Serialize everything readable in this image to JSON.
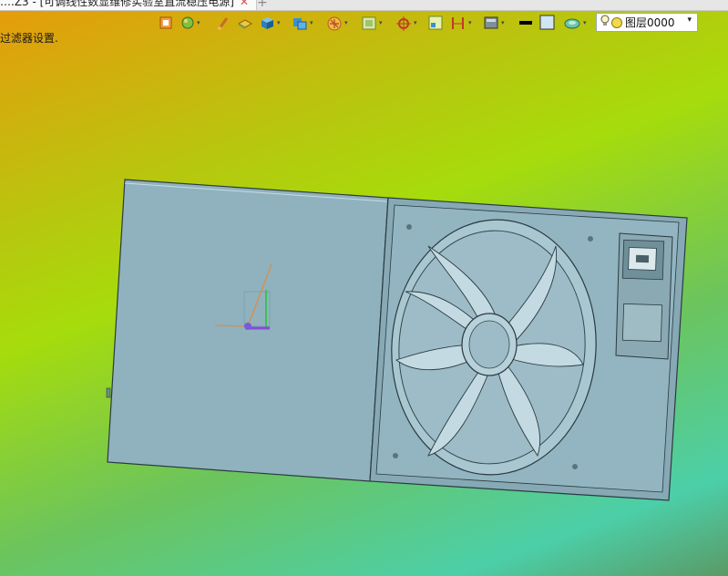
{
  "tab": {
    "title": "….Z3 - [可调线性数显维修实验室直流稳压电源]",
    "close_glyph": "✕",
    "add_glyph": "+"
  },
  "toolbar": {
    "icons": [
      "import-icon",
      "paint-icon",
      "brush-icon",
      "layer-block-icon",
      "solid-cube-icon",
      "view-cube-icon",
      "render-icon",
      "frame-icon",
      "snap-icon",
      "measure-box-icon",
      "dimension-icon",
      "display-icon",
      "line-color-icon",
      "fill-color-icon",
      "material-icon"
    ],
    "dropdown_glyph": "▾",
    "layer": {
      "name": "图层0000",
      "arrow": "▾"
    }
  },
  "status": {
    "hint": "过滤器设置."
  },
  "colors": {
    "model_fill": "#8fb2be",
    "model_edge": "#2b3a40",
    "toolbar_bg": "#e6e6e6"
  }
}
